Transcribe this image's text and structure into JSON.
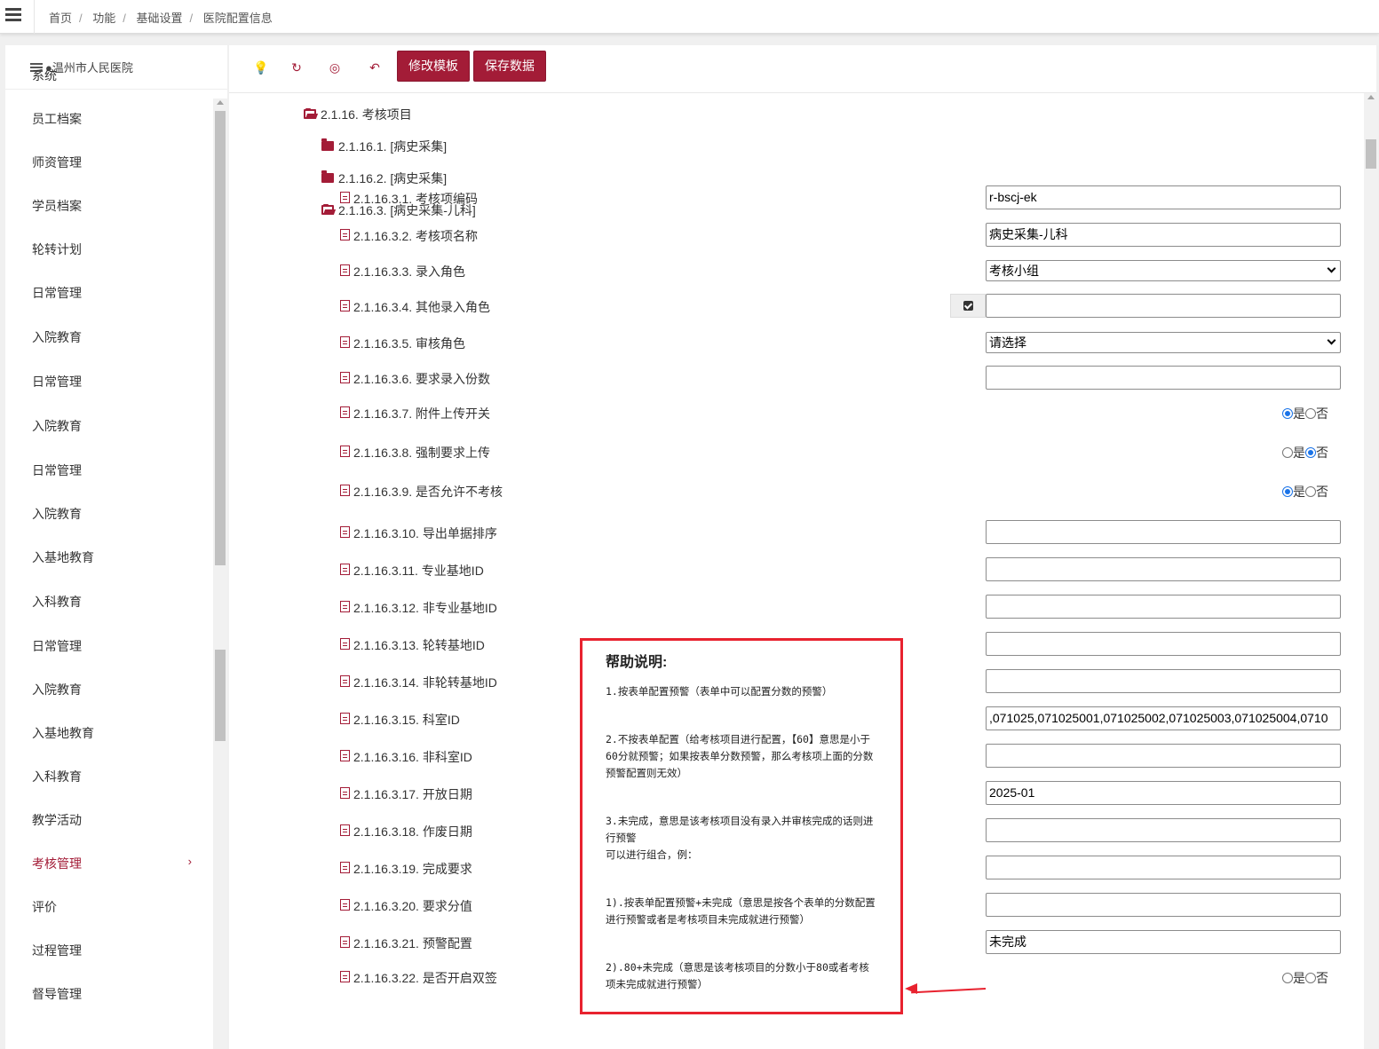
{
  "breadcrumb": [
    "首页",
    "功能",
    "基础设置",
    "医院配置信息"
  ],
  "hospital": "●温州市人民医院",
  "sidebar_menu": [
    "系统",
    "员工档案",
    "师资管理",
    "学员档案",
    "轮转计划",
    "日常管理",
    "入院教育",
    "日常管理",
    "入院教育",
    "日常管理",
    "入院教育",
    "入基地教育",
    "入科教育",
    "日常管理",
    "入院教育",
    "入基地教育",
    "入科教育",
    "教学活动",
    "考核管理",
    "评价",
    "过程管理",
    "督导管理"
  ],
  "sidebar_active_index": 18,
  "sidebar_chevron": "›",
  "toolbar": {
    "edit_template": "修改模板",
    "save_data": "保存数据"
  },
  "tree": {
    "root": "2.1.16. 考核项目",
    "children": [
      "2.1.16.1. [病史采集]",
      "2.1.16.2. [病史采集]",
      "2.1.16.3. [病史采集-儿科]"
    ]
  },
  "fields": [
    {
      "label": "2.1.16.3.1. 考核项编码",
      "type": "text",
      "value": "r-bscj-ek"
    },
    {
      "label": "2.1.16.3.2. 考核项名称",
      "type": "text",
      "value": "病史采集-儿科"
    },
    {
      "label": "2.1.16.3.3. 录入角色",
      "type": "select",
      "value": "考核小组"
    },
    {
      "label": "2.1.16.3.4. 其他录入角色",
      "type": "checktext",
      "value": ""
    },
    {
      "label": "2.1.16.3.5. 审核角色",
      "type": "select",
      "value": "请选择"
    },
    {
      "label": "2.1.16.3.6. 要求录入份数",
      "type": "text",
      "value": ""
    },
    {
      "label": "2.1.16.3.7. 附件上传开关",
      "type": "radio",
      "value": "是"
    },
    {
      "label": "2.1.16.3.8. 强制要求上传",
      "type": "radio",
      "value": "否"
    },
    {
      "label": "2.1.16.3.9. 是否允许不考核",
      "type": "radio",
      "value": "是"
    },
    {
      "label": "2.1.16.3.10. 导出单据排序",
      "type": "text",
      "value": ""
    },
    {
      "label": "2.1.16.3.11. 专业基地ID",
      "type": "text",
      "value": ""
    },
    {
      "label": "2.1.16.3.12. 非专业基地ID",
      "type": "text",
      "value": ""
    },
    {
      "label": "2.1.16.3.13. 轮转基地ID",
      "type": "text",
      "value": ""
    },
    {
      "label": "2.1.16.3.14. 非轮转基地ID",
      "type": "text",
      "value": ""
    },
    {
      "label": "2.1.16.3.15. 科室ID",
      "type": "text",
      "value": ",071025,071025001,071025002,071025003,071025004,0710"
    },
    {
      "label": "2.1.16.3.16. 非科室ID",
      "type": "text",
      "value": ""
    },
    {
      "label": "2.1.16.3.17. 开放日期",
      "type": "text",
      "value": "2025-01"
    },
    {
      "label": "2.1.16.3.18. 作废日期",
      "type": "text",
      "value": ""
    },
    {
      "label": "2.1.16.3.19. 完成要求",
      "type": "text",
      "value": ""
    },
    {
      "label": "2.1.16.3.20. 要求分值",
      "type": "text",
      "value": ""
    },
    {
      "label": "2.1.16.3.21. 预警配置",
      "type": "text",
      "value": "未完成"
    },
    {
      "label": "2.1.16.3.22. 是否开启双签",
      "type": "radio",
      "value": ""
    }
  ],
  "radio_labels": {
    "yes": "是",
    "no": "否"
  },
  "help": {
    "title": "帮助说明:",
    "paragraphs": [
      "1.按表单配置预警（表单中可以配置分数的预警）",
      "2.不按表单配置（给考核项目进行配置，【60】意思是小于60分就预警；如果按表单分数预警，那么考核项上面的分数预警配置则无效）",
      "3.未完成，意思是该考核项目没有录入并审核完成的话则进行预警\n可以进行组合，例：",
      "1).按表单配置预警+未完成（意思是按各个表单的分数配置进行预警或者是考核项目未完成就进行预警）",
      "2).80+未完成（意思是该考核项目的分数小于80或者考核项未完成就进行预警）"
    ]
  },
  "colors": {
    "accent": "#a31c37",
    "highlight": "#e8222f",
    "radio_on": "#1a73e8"
  }
}
